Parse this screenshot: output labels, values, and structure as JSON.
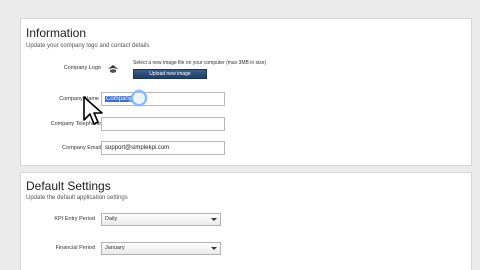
{
  "information": {
    "title": "Information",
    "subtitle": "Update your company logo and contact details",
    "logo_label": "Company Logo",
    "upload_hint": "Select a new image file on your computer (max 3MB in size)",
    "upload_button": "Upload new image",
    "name_label": "Company Name",
    "name_value": "Company",
    "phone_label": "Company Telephone",
    "phone_value": "",
    "email_label": "Company Email",
    "email_value": "support@simplekpi.com"
  },
  "defaults": {
    "title": "Default Settings",
    "subtitle": "Update the default application settings",
    "kpi_label": "KPI Entry Period",
    "kpi_value": "Daily",
    "financial_label": "Financial Period",
    "financial_value": "January"
  },
  "colors": {
    "accent": "#3a6fd8",
    "button": "#2a4a75"
  }
}
